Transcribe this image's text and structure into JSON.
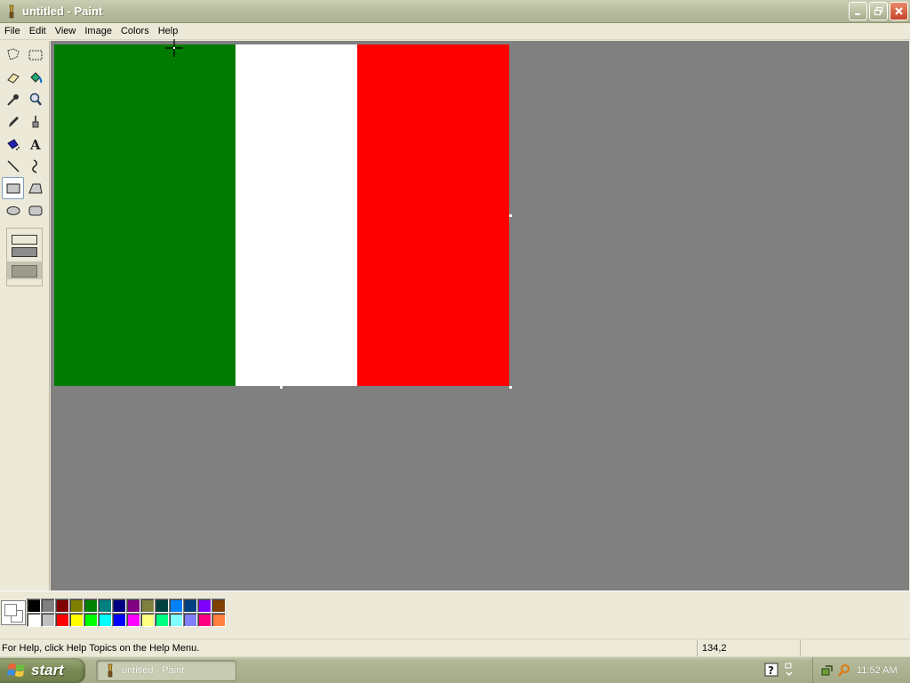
{
  "window": {
    "title": "untitled - Paint",
    "controls": [
      "minimize",
      "restore",
      "close"
    ]
  },
  "menu": {
    "items": [
      "File",
      "Edit",
      "View",
      "Image",
      "Colors",
      "Help"
    ]
  },
  "toolbox": {
    "tools": [
      {
        "name": "free-form-select-icon",
        "selected": false
      },
      {
        "name": "rect-select-icon",
        "selected": false
      },
      {
        "name": "eraser-icon",
        "selected": false
      },
      {
        "name": "fill-bucket-icon",
        "selected": false
      },
      {
        "name": "color-picker-icon",
        "selected": false
      },
      {
        "name": "magnifier-icon",
        "selected": false
      },
      {
        "name": "pencil-icon",
        "selected": false
      },
      {
        "name": "brush-icon",
        "selected": false
      },
      {
        "name": "airbrush-icon",
        "selected": false
      },
      {
        "name": "text-icon",
        "selected": false
      },
      {
        "name": "line-icon",
        "selected": false
      },
      {
        "name": "curve-icon",
        "selected": false
      },
      {
        "name": "rectangle-icon",
        "selected": true
      },
      {
        "name": "polygon-icon",
        "selected": false
      },
      {
        "name": "ellipse-icon",
        "selected": false
      },
      {
        "name": "rounded-rect-icon",
        "selected": false
      }
    ],
    "fill_style_selected": "filled"
  },
  "canvas": {
    "background": "#808080",
    "stripes": [
      {
        "name": "green-stripe",
        "color": "#007a00"
      },
      {
        "name": "white-stripe",
        "color": "#ffffff"
      },
      {
        "name": "red-stripe",
        "color": "#ff0000"
      }
    ]
  },
  "colors": {
    "foreground": "#ffffff",
    "background": "#ffffff",
    "palette_row1": [
      "#000000",
      "#808080",
      "#800000",
      "#808000",
      "#008000",
      "#008080",
      "#000080",
      "#800080",
      "#808040",
      "#004040",
      "#0080ff",
      "#004080",
      "#8000ff",
      "#804000"
    ],
    "palette_row2": [
      "#ffffff",
      "#c0c0c0",
      "#ff0000",
      "#ffff00",
      "#00ff00",
      "#00ffff",
      "#0000ff",
      "#ff00ff",
      "#ffff80",
      "#00ff80",
      "#80ffff",
      "#8080ff",
      "#ff0080",
      "#ff8040"
    ]
  },
  "status": {
    "help_text": "For Help, click Help Topics on the Help Menu.",
    "coords": "134,2",
    "size": ""
  },
  "taskbar": {
    "start_label": "start",
    "task_label": "untitled - Paint",
    "clock": "11:52 AM"
  }
}
